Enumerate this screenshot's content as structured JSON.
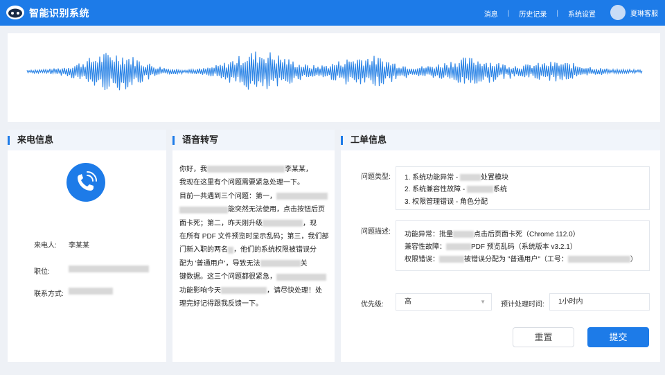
{
  "app": {
    "title": "智能识别系统"
  },
  "nav": [
    {
      "label": "消息"
    },
    {
      "label": "历史记录"
    },
    {
      "label": "系统设置"
    }
  ],
  "user": {
    "name": "夏琳客服"
  },
  "colors": {
    "accent": "#1d7be8",
    "panel_head": "#f1f5fb",
    "wave": "#2f86e6"
  },
  "caller": {
    "heading": "来电信息",
    "icon": "phone-call-icon",
    "name_label": "来电人:",
    "name_value": "李某某",
    "position_label": "职位:",
    "contact_label": "联系方式:"
  },
  "transcript": {
    "heading": "语音转写",
    "lines": [
      [
        "你好，我",
        "BLUR:112",
        "李某某，"
      ],
      [
        "我现在这里有个问题需要紧急处理一下。"
      ],
      [
        "目前一共遇到三个问题：第一，",
        "BLUR:74"
      ],
      [
        "BLUR:70",
        "能突然无法使用，点击按钮后页"
      ],
      [
        "面卡死；第二，昨天刚升级",
        "BLUR:58",
        "，现"
      ],
      [
        "在所有 PDF 文件预览时显示乱码；第三，我们部"
      ],
      [
        "门新入职的两名",
        "BLUR:8",
        "，他们的系统权限被错误分"
      ],
      [
        "配为 '普通用户'，导致无法",
        "BLUR:58",
        "关"
      ],
      [
        "键数据。这三个问题都很紧急，",
        "BLUR:72"
      ],
      [
        "功能影响今天",
        "BLUR:66",
        "，请尽快处理！处"
      ],
      [
        "理完好记得跟我反馈一下。"
      ]
    ]
  },
  "ticket": {
    "heading": "工单信息",
    "type_label": "问题类型:",
    "type_lines": [
      [
        "1. 系统功能异常 - ",
        "BLUR:30",
        "处置模块"
      ],
      [
        "2. 系统兼容性故障 - ",
        "BLUR:38",
        "系统"
      ],
      [
        "3. 权限管理错误 - 角色分配"
      ]
    ],
    "desc_label": "问题描述:",
    "desc_lines": [
      [
        "功能异常：批量",
        "BLUR:30",
        "点击后页面卡死（Chrome 112.0）"
      ],
      [
        "兼容性故障：",
        "BLUR:36",
        "PDF 预览乱码（系统版本 v3.2.1）"
      ],
      [
        "权限错误：",
        "BLUR:36",
        "被错误分配为 \"普通用户\"（工号：",
        "BLUR:90",
        "）"
      ]
    ],
    "priority_label": "优先级:",
    "priority_value": "高",
    "eta_label": "预计处理时间:",
    "eta_value": "1小时内",
    "reset_label": "重置",
    "submit_label": "提交"
  }
}
